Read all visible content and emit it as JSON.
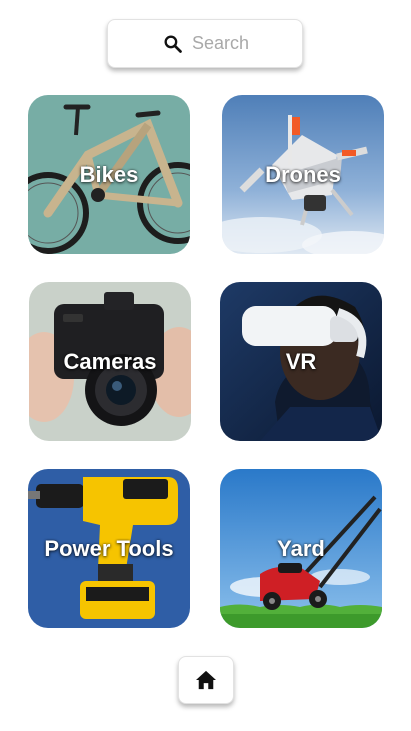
{
  "search": {
    "placeholder": "Search",
    "icon": "search-icon"
  },
  "categories": [
    {
      "label": "Bikes"
    },
    {
      "label": "Drones"
    },
    {
      "label": "Cameras"
    },
    {
      "label": "VR"
    },
    {
      "label": "Power Tools"
    },
    {
      "label": "Yard"
    }
  ],
  "home": {
    "icon": "home-icon"
  }
}
